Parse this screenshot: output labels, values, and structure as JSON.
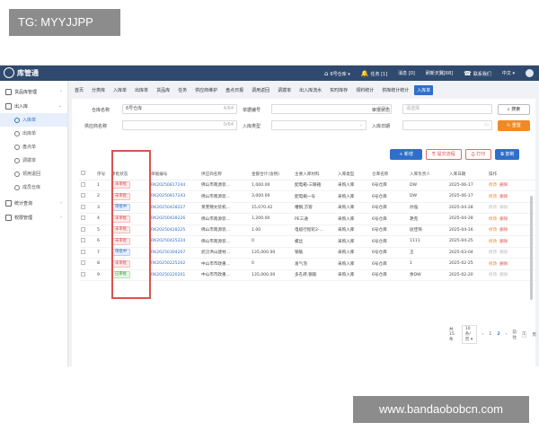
{
  "watermark_top": "TG: MYYJJPP",
  "watermark_bottom": "www.bandaobobcn.com",
  "app": {
    "logo_text": "库管通",
    "warehouse": "6号仓库",
    "notice": "任务 [1]",
    "message": "消息 [0]",
    "user": "刷新天翼[68]",
    "contact": "联系我们",
    "lang": "中文"
  },
  "sidebar": {
    "items": [
      {
        "label": "货品库管理"
      },
      {
        "label": "出入库"
      },
      {
        "label": "入库单"
      },
      {
        "label": "出库单"
      },
      {
        "label": "盘点单"
      },
      {
        "label": "调拨单"
      },
      {
        "label": "领用退回"
      },
      {
        "label": "成员仓库"
      },
      {
        "label": "统计查询"
      },
      {
        "label": "权限管理"
      }
    ]
  },
  "tabs": [
    "首页",
    "分类库",
    "入库单",
    "出库单",
    "货品库",
    "任务",
    "供应商维护",
    "盘点日报",
    "调用返回",
    "调拨单",
    "出入库流水",
    "实时库存",
    "领料统计",
    "供库统计统计",
    "入库单"
  ],
  "filters": {
    "warehouse_label": "仓库名称",
    "warehouse_value": "6号仓库",
    "warehouse_count": "4/64",
    "doc_no_label": "单据编号",
    "doc_no_count": "0/32",
    "status_label": "审批状态",
    "status_placeholder": "请选择",
    "supplier_label": "供应商名称",
    "supplier_count": "0/64",
    "in_type_label": "入库类型",
    "in_date_label": "入库日期",
    "search_label": "搜索",
    "reset_label": "重置"
  },
  "actions": {
    "new_label": "新增",
    "submit_label": "提交流程",
    "print_label": "打印",
    "copy_label": "复制"
  },
  "table": {
    "headers": [
      "序号",
      "审批状态",
      "单据编号",
      "供应商名称",
      "金额合计(含税)",
      "主要入库材料",
      "入库类型",
      "仓库名称",
      "入库负责人",
      "入库日期",
      "操作"
    ],
    "rows": [
      {
        "no": "1",
        "status": "未审批",
        "status_kind": "unaudited",
        "doc": "RK20250817244",
        "supplier": "佛山市南源装…",
        "amount": "1,000.00",
        "material": "配电箱-三联箱",
        "type": "采购入库",
        "wh": "6号仓库",
        "owner": "DW",
        "date": "2025-06-17"
      },
      {
        "no": "2",
        "status": "未审批",
        "status_kind": "unaudited",
        "doc": "RK20250817243",
        "supplier": "佛山市南源装…",
        "amount": "3,000.00",
        "material": "配电箱一号",
        "type": "采购入库",
        "wh": "6号仓库",
        "owner": "DW",
        "date": "2025-06-17"
      },
      {
        "no": "3",
        "status": "审批中",
        "status_kind": "auditing",
        "doc": "RK20250428227",
        "supplier": "莱芜锦文装机…",
        "amount": "15,070.42",
        "material": "槽钢,方管",
        "type": "采购入库",
        "wh": "6号仓库",
        "owner": "孙强",
        "date": "2025-04-28"
      },
      {
        "no": "4",
        "status": "未审批",
        "status_kind": "unaudited",
        "doc": "RK20250428226",
        "supplier": "佛山市南源装…",
        "amount": "1,200.00",
        "material": "PE三通",
        "type": "采购入库",
        "wh": "6号仓库",
        "owner": "艳克",
        "date": "2025-04-28"
      },
      {
        "no": "5",
        "status": "未审批",
        "status_kind": "unaudited",
        "doc": "RK20250428225",
        "supplier": "佛山市南源装…",
        "amount": "1.00",
        "material": "电缆行程轮2-…",
        "type": "采购入库",
        "wh": "6号仓库",
        "owner": "屈佳琦",
        "date": "2025-04-16"
      },
      {
        "no": "6",
        "status": "未审批",
        "status_kind": "unaudited",
        "doc": "RK20250425224",
        "supplier": "佛山市南源装…",
        "amount": "0",
        "material": "螺丝",
        "type": "采购入库",
        "wh": "6号仓库",
        "owner": "1111",
        "date": "2025-04-25"
      },
      {
        "no": "7",
        "status": "审批中",
        "status_kind": "auditing",
        "doc": "RK20250304207",
        "supplier": "武汉洪山建材…",
        "amount": "135,000.00",
        "material": "钢筋",
        "type": "采购入库",
        "wh": "6号仓库",
        "owner": "王",
        "date": "2025-03-04"
      },
      {
        "no": "8",
        "status": "未审批",
        "status_kind": "unaudited",
        "doc": "RK20250225202",
        "supplier": "中山市市政重…",
        "amount": "0",
        "material": "发气泡",
        "type": "采购入库",
        "wh": "6号仓库",
        "owner": "1",
        "date": "2025-02-25"
      },
      {
        "no": "9",
        "status": "已审批",
        "status_kind": "audited",
        "doc": "RK20250220201",
        "supplier": "中山市市政重…",
        "amount": "135,000.00",
        "material": "多孔砖,钢筋",
        "type": "采购入库",
        "wh": "6号仓库",
        "owner": "余DW",
        "date": "2025-02-20"
      }
    ],
    "op_edit": "修改",
    "op_delete": "删除"
  },
  "pager": {
    "total": "共 15 条",
    "page_size": "10条/页",
    "pages": [
      "1",
      "2"
    ],
    "goto_label": "前往",
    "goto_value": "1",
    "page_unit": "页"
  }
}
